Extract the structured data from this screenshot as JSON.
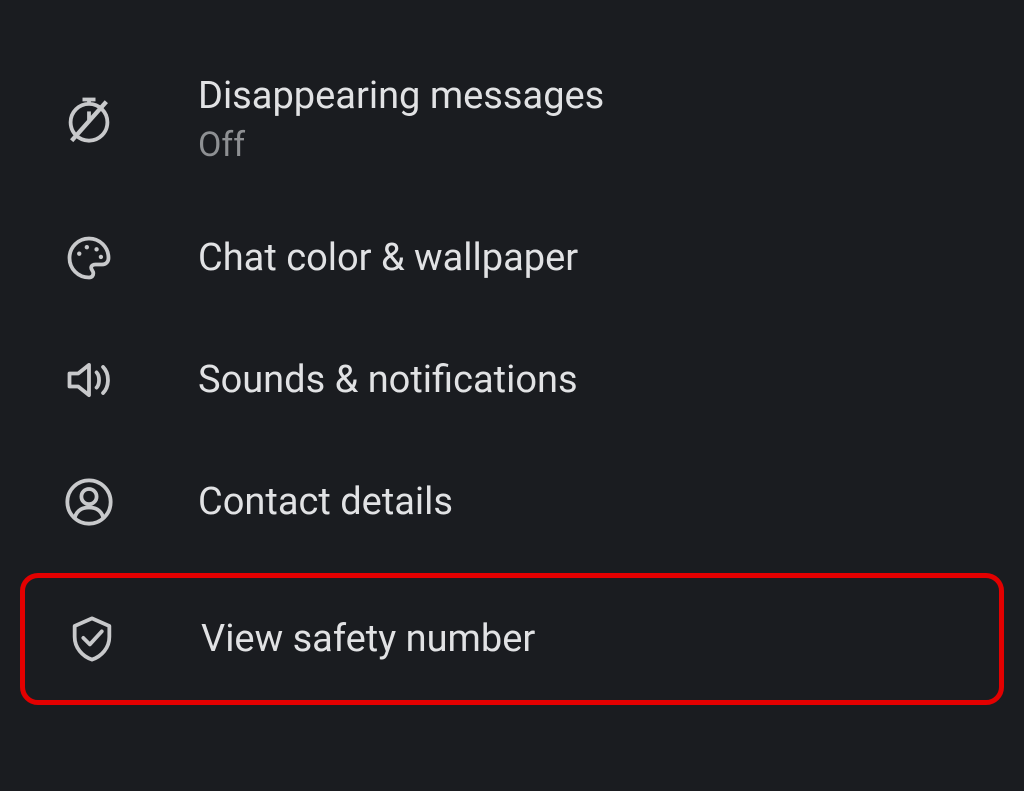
{
  "settings": {
    "items": [
      {
        "title": "Disappearing messages",
        "subtitle": "Off"
      },
      {
        "title": "Chat color & wallpaper"
      },
      {
        "title": "Sounds & notifications"
      },
      {
        "title": "Contact details"
      },
      {
        "title": "View safety number"
      }
    ]
  }
}
